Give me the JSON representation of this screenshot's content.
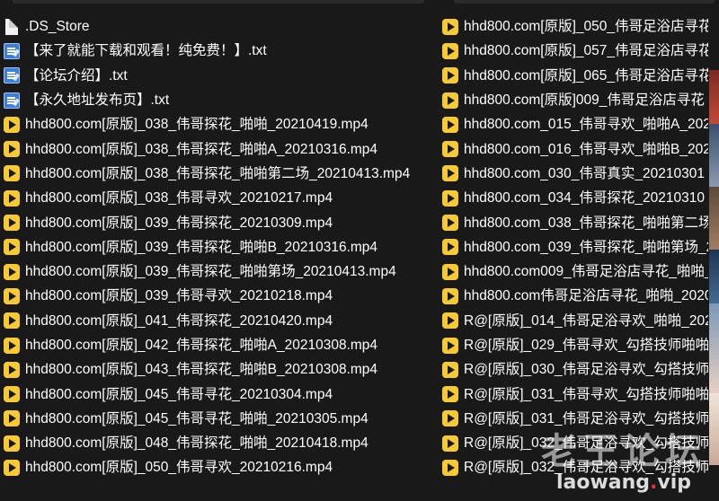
{
  "left_column": [
    {
      "name": ".DS_Store",
      "icon": "blank-file-icon"
    },
    {
      "name": "【来了就能下载和观看！纯免费！】.txt",
      "icon": "text-file-icon"
    },
    {
      "name": "【论坛介绍】.txt",
      "icon": "text-file-icon"
    },
    {
      "name": "【永久地址发布页】.txt",
      "icon": "text-file-icon"
    },
    {
      "name": "hhd800.com[原版]_038_伟哥探花_啪啪_20210419.mp4",
      "icon": "video-file-icon"
    },
    {
      "name": "hhd800.com[原版]_038_伟哥探花_啪啪A_20210316.mp4",
      "icon": "video-file-icon"
    },
    {
      "name": "hhd800.com[原版]_038_伟哥探花_啪啪第二场_20210413.mp4",
      "icon": "video-file-icon"
    },
    {
      "name": "hhd800.com[原版]_038_伟哥寻欢_20210217.mp4",
      "icon": "video-file-icon"
    },
    {
      "name": "hhd800.com[原版]_039_伟哥探花_20210309.mp4",
      "icon": "video-file-icon"
    },
    {
      "name": "hhd800.com[原版]_039_伟哥探花_啪啪B_20210316.mp4",
      "icon": "video-file-icon"
    },
    {
      "name": "hhd800.com[原版]_039_伟哥探花_啪啪第场_20210413.mp4",
      "icon": "video-file-icon"
    },
    {
      "name": "hhd800.com[原版]_039_伟哥寻欢_20210218.mp4",
      "icon": "video-file-icon"
    },
    {
      "name": "hhd800.com[原版]_041_伟哥探花_20210420.mp4",
      "icon": "video-file-icon"
    },
    {
      "name": "hhd800.com[原版]_042_伟哥探花_啪啪A_20210308.mp4",
      "icon": "video-file-icon"
    },
    {
      "name": "hhd800.com[原版]_043_伟哥探花_啪啪B_20210308.mp4",
      "icon": "video-file-icon"
    },
    {
      "name": "hhd800.com[原版]_045_伟哥寻花_20210304.mp4",
      "icon": "video-file-icon"
    },
    {
      "name": "hhd800.com[原版]_045_伟哥寻花_啪啪_20210305.mp4",
      "icon": "video-file-icon"
    },
    {
      "name": "hhd800.com[原版]_048_伟哥探花_啪啪_20210418.mp4",
      "icon": "video-file-icon"
    },
    {
      "name": "hhd800.com[原版]_050_伟哥寻欢_20210216.mp4",
      "icon": "video-file-icon"
    }
  ],
  "right_column": [
    {
      "name": "hhd800.com[原版]_050_伟哥足浴店寻花",
      "icon": "video-file-icon"
    },
    {
      "name": "hhd800.com[原版]_057_伟哥足浴店寻花",
      "icon": "video-file-icon"
    },
    {
      "name": "hhd800.com[原版]_065_伟哥足浴店寻花",
      "icon": "video-file-icon"
    },
    {
      "name": "hhd800.com[原版]009_伟哥足浴店寻花",
      "icon": "video-file-icon"
    },
    {
      "name": "hhd800.com_015_伟哥寻欢_啪啪A_202",
      "icon": "video-file-icon"
    },
    {
      "name": "hhd800.com_016_伟哥寻欢_啪啪B_202",
      "icon": "video-file-icon"
    },
    {
      "name": "hhd800.com_030_伟哥真实_20210301",
      "icon": "video-file-icon"
    },
    {
      "name": "hhd800.com_034_伟哥探花_20210310",
      "icon": "video-file-icon"
    },
    {
      "name": "hhd800.com_038_伟哥探花_啪啪第二场",
      "icon": "video-file-icon"
    },
    {
      "name": "hhd800.com_039_伟哥探花_啪啪第场_2",
      "icon": "video-file-icon"
    },
    {
      "name": "hhd800.com009_伟哥足浴店寻花_啪啪_",
      "icon": "video-file-icon"
    },
    {
      "name": "hhd800.com伟哥足浴店寻花_啪啪_2020",
      "icon": "video-file-icon"
    },
    {
      "name": "R@[原版]_014_伟哥足浴寻欢_啪啪_202",
      "icon": "video-file-icon"
    },
    {
      "name": "R@[原版]_029_伟哥寻欢_勾搭技师啪啪",
      "icon": "video-file-icon"
    },
    {
      "name": "R@[原版]_030_伟哥足浴寻欢_勾搭技师啪",
      "icon": "video-file-icon"
    },
    {
      "name": "R@[原版]_031_伟哥寻欢_勾搭技师啪啪",
      "icon": "video-file-icon"
    },
    {
      "name": "R@[原版]_031_伟哥足浴寻欢_勾搭技师啪",
      "icon": "video-file-icon"
    },
    {
      "name": "R@[原版]_032_伟哥足浴寻欢_勾搭技师啪",
      "icon": "video-file-icon"
    },
    {
      "name": "R@[原版]_032_伟哥足浴寻欢_勾搭技师啪",
      "icon": "video-file-icon"
    }
  ],
  "watermark": {
    "cn": "老王论坛",
    "en_main": "laowang",
    "en_dot": ".",
    "en_tld": "vip"
  },
  "colors": {
    "background": "#191919",
    "text": "#ffffff",
    "video_icon": "#f7c933",
    "text_file_icon": "#3d7fd8"
  }
}
